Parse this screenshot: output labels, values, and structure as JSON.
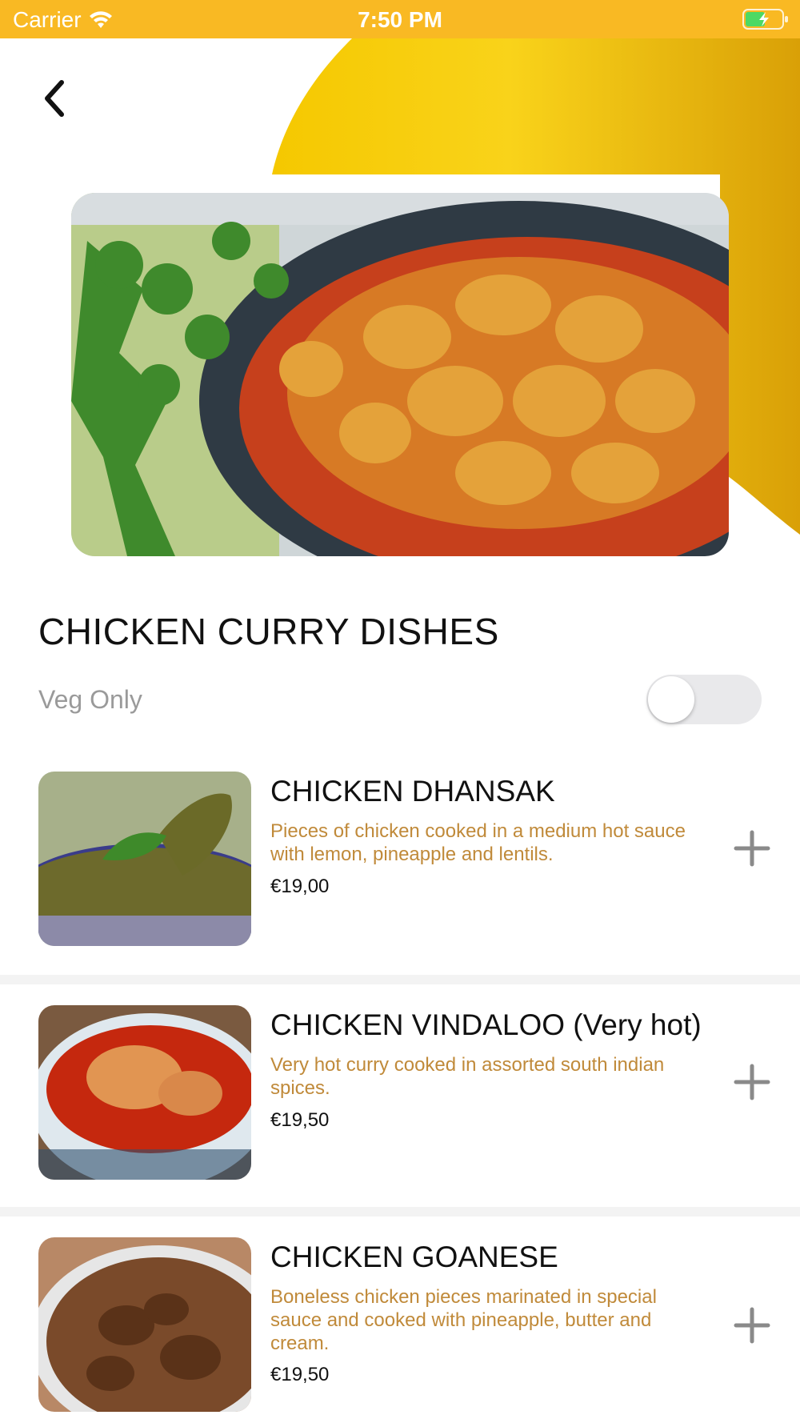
{
  "status_bar": {
    "carrier": "Carrier",
    "time": "7:50 PM",
    "wifi_icon": "wifi-icon",
    "battery_icon": "battery-charging-icon"
  },
  "colors": {
    "accent": "#F9B923",
    "description_text": "#C08A3A",
    "muted_text": "#9A9A9A"
  },
  "header": {
    "back_icon": "chevron-left-icon",
    "hero_image": "chicken curry dish photo"
  },
  "category": {
    "title": "CHICKEN CURRY DISHES"
  },
  "filter": {
    "veg_only_label": "Veg Only",
    "veg_only_enabled": false
  },
  "items": [
    {
      "name": "CHICKEN DHANSAK",
      "description": "Pieces of chicken cooked in a medium hot sauce with lemon, pineapple and lentils.",
      "price": "€19,00",
      "add_icon": "plus-icon"
    },
    {
      "name": "CHICKEN VINDALOO (Very hot)",
      "description": "Very hot curry cooked in assorted south indian spices.",
      "price": "€19,50",
      "add_icon": "plus-icon"
    },
    {
      "name": "CHICKEN GOANESE",
      "description": "Boneless chicken pieces marinated in special sauce and cooked with pineapple, butter and cream.",
      "price": "€19,50",
      "add_icon": "plus-icon"
    }
  ]
}
